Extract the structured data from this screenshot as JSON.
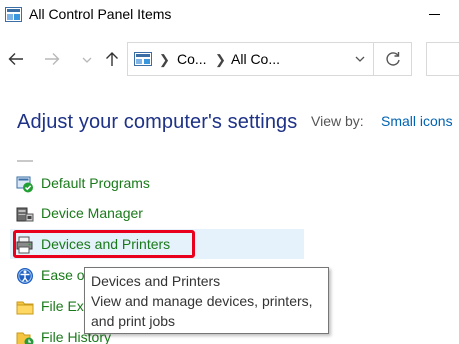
{
  "window": {
    "title": "All Control Panel Items"
  },
  "nav": {
    "address_segments": [
      "Co...",
      "All Co..."
    ]
  },
  "content": {
    "heading": "Adjust your computer's settings",
    "view_by_label": "View by:",
    "view_by_value": "Small icons",
    "items": [
      {
        "label": "Default Programs",
        "icon": "default-programs-icon"
      },
      {
        "label": "Device Manager",
        "icon": "device-manager-icon"
      },
      {
        "label": "Devices and Printers",
        "icon": "devices-printers-icon",
        "hovered": true,
        "highlighted": true
      },
      {
        "label": "Ease o",
        "icon": "ease-of-access-icon"
      },
      {
        "label": "File Ex",
        "icon": "file-explorer-options-icon"
      },
      {
        "label": "File History",
        "icon": "file-history-icon"
      }
    ]
  },
  "tooltip": {
    "title": "Devices and Printers",
    "line1": "View and manage devices, printers,",
    "line2": "and print jobs"
  },
  "colors": {
    "heading": "#1e3287",
    "item_text": "#1a7a1a",
    "link": "#0063b1",
    "highlight_border": "#e8001c",
    "hover_bg": "#e5f1fb"
  }
}
